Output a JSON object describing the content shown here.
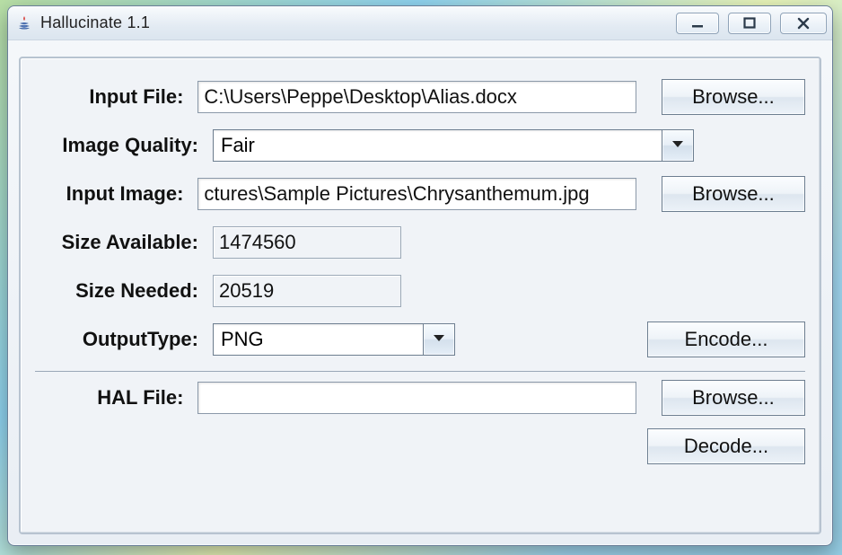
{
  "window": {
    "title": "Hallucinate 1.1"
  },
  "labels": {
    "input_file": "Input File:",
    "image_quality": "Image Quality:",
    "input_image": "Input Image:",
    "size_available": "Size Available:",
    "size_needed": "Size Needed:",
    "output_type": "OutputType:",
    "hal_file": "HAL File:"
  },
  "fields": {
    "input_file": "C:\\Users\\Peppe\\Desktop\\Alias.docx",
    "image_quality": "Fair",
    "input_image": "ctures\\Sample Pictures\\Chrysanthemum.jpg",
    "size_available": "1474560",
    "size_needed": "20519",
    "output_type": "PNG",
    "hal_file": ""
  },
  "buttons": {
    "browse": "Browse...",
    "encode": "Encode...",
    "decode": "Decode..."
  }
}
